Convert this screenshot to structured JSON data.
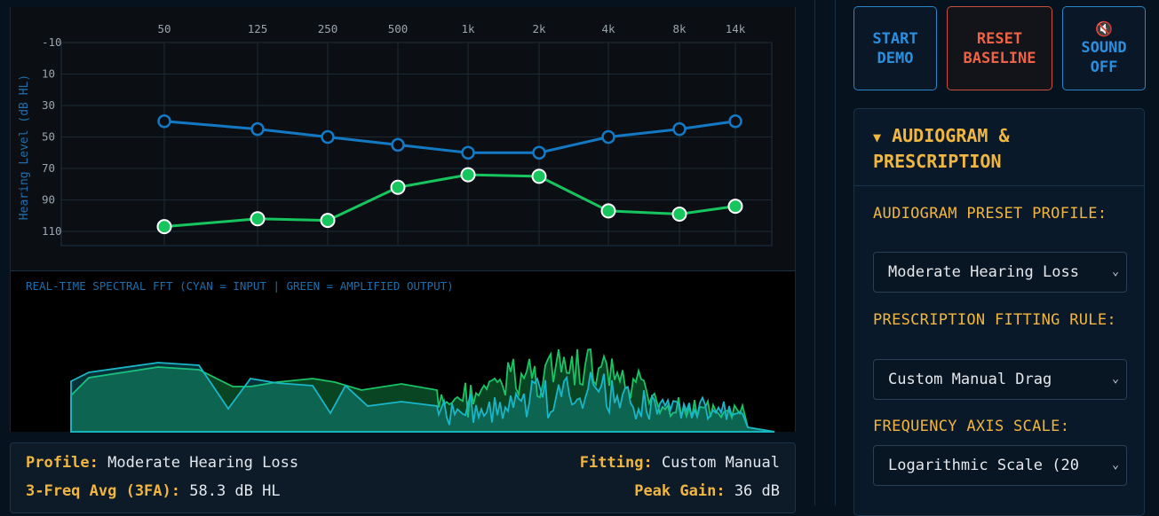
{
  "audiogram": {
    "x_ticks": [
      "50",
      "125",
      "250",
      "500",
      "1k",
      "2k",
      "4k",
      "8k",
      "14k"
    ],
    "y_ticks": [
      "-10",
      "10",
      "30",
      "50",
      "70",
      "90",
      "110"
    ],
    "y_label": "Hearing Level (dB HL)",
    "colors": {
      "threshold": "#1479c4",
      "prescription": "#17c55e",
      "axis_text": "#1e6fad",
      "grid": "#1c2a36"
    }
  },
  "chart_data": {
    "type": "line",
    "x": [
      "50",
      "125",
      "250",
      "500",
      "1k",
      "2k",
      "4k",
      "8k",
      "14k"
    ],
    "ylabel": "Hearing Level (dB HL)",
    "ylim": [
      -10,
      110
    ],
    "y_inverted": true,
    "grid": true,
    "series": [
      {
        "values": [
          40,
          45,
          50,
          55,
          60,
          60,
          50,
          45,
          40
        ],
        "color": "#1479c4",
        "marker": "open-circle"
      },
      {
        "values": [
          107,
          102,
          103,
          82,
          74,
          75,
          97,
          99,
          94
        ],
        "color": "#17c55e",
        "marker": "filled-circle"
      }
    ]
  },
  "spectrum": {
    "title": "REAL-TIME SPECTRAL FFT (CYAN = INPUT | GREEN = AMPLIFIED OUTPUT)",
    "colors": {
      "input": "#19b6c8",
      "output": "#19c465",
      "title": "#1a6fae"
    }
  },
  "summary": {
    "profile_key": "Profile:",
    "profile_value": "Moderate Hearing Loss",
    "fitting_key": "Fitting:",
    "fitting_value": "Custom Manual",
    "avg_key": "3-Freq Avg (3FA):",
    "avg_value": "58.3 dB HL",
    "peak_key": "Peak Gain:",
    "peak_value": "36 dB"
  },
  "controls": {
    "start_demo": [
      "START",
      "DEMO"
    ],
    "reset_baseline": [
      "RESET",
      "BASELINE"
    ],
    "sound_icon": "🔇",
    "sound_off": [
      "SOUND",
      "OFF"
    ]
  },
  "panel": {
    "caret": "▼",
    "title": "AUDIOGRAM & PRESCRIPTION",
    "preset_label": "AUDIOGRAM PRESET PROFILE:",
    "preset_value": "Moderate Hearing Loss",
    "fitting_label": "PRESCRIPTION FITTING RULE:",
    "fitting_value": "Custom Manual Drag",
    "scale_label": "FREQUENCY AXIS SCALE:",
    "scale_value": "Logarithmic Scale (20",
    "chevron_icon": "chevron-down-icon"
  }
}
